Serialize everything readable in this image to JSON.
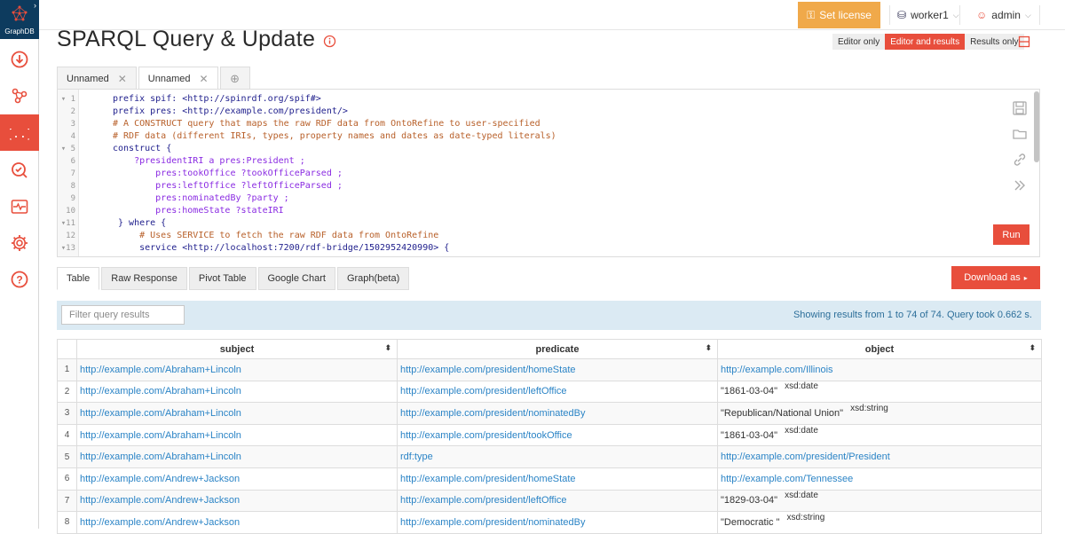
{
  "sidebar": {
    "logo_text": "GraphDB",
    "items": [
      {
        "name": "import",
        "active": false
      },
      {
        "name": "explore",
        "active": false
      },
      {
        "name": "sparql",
        "active": true
      },
      {
        "name": "monitor",
        "active": false
      },
      {
        "name": "activity",
        "active": false
      },
      {
        "name": "setup",
        "active": false
      },
      {
        "name": "help",
        "active": false
      }
    ]
  },
  "topbar": {
    "set_license": "Set license",
    "worker": "worker1",
    "admin": "admin"
  },
  "page": {
    "title": "SPARQL Query & Update"
  },
  "view_mode": {
    "editor_only": "Editor only",
    "editor_and_results": "Editor and results",
    "results_only": "Results only"
  },
  "query_tabs": [
    {
      "label": "Unnamed",
      "active": false
    },
    {
      "label": "Unnamed",
      "active": true
    }
  ],
  "editor": {
    "line_numbers": [
      "▾ 1",
      "2",
      "3",
      "4",
      "▾ 5",
      "6",
      "7",
      "8",
      "9",
      "10",
      "▾11",
      "12",
      "▾13"
    ],
    "lines": [
      "prefix spif: <http://spinrdf.org/spif#>",
      "prefix pres: <http://example.com/president/>",
      "# A CONSTRUCT query that maps the raw RDF data from OntoRefine to user-specified",
      "# RDF data (different IRIs, types, property names and dates as date-typed literals)",
      "construct {",
      "    ?presidentIRI a pres:President ;",
      "        pres:tookOffice ?tookOfficeParsed ;",
      "        pres:leftOffice ?leftOfficeParsed ;",
      "        pres:nominatedBy ?party ;",
      "        pres:homeState ?stateIRI",
      " } where {",
      "     # Uses SERVICE to fetch the raw RDF data from OntoRefine",
      "     service <http://localhost:7200/rdf-bridge/1502952420990> {"
    ],
    "run_label": "Run"
  },
  "result_tabs": [
    "Table",
    "Raw Response",
    "Pivot Table",
    "Google Chart",
    "Graph(beta)"
  ],
  "download_label": "Download as",
  "filter": {
    "placeholder": "Filter query results",
    "summary": "Showing results from 1 to 74 of 74. Query took 0.662 s."
  },
  "table": {
    "columns": [
      "subject",
      "predicate",
      "object"
    ],
    "rows": [
      {
        "n": "1",
        "s": "http://example.com/Abraham+Lincoln",
        "p": "http://example.com/president/homeState",
        "o": "http://example.com/Illinois",
        "o_type": "link",
        "dt": ""
      },
      {
        "n": "2",
        "s": "http://example.com/Abraham+Lincoln",
        "p": "http://example.com/president/leftOffice",
        "o": "\"1861-03-04\"",
        "o_type": "lit",
        "dt": "xsd:date"
      },
      {
        "n": "3",
        "s": "http://example.com/Abraham+Lincoln",
        "p": "http://example.com/president/nominatedBy",
        "o": "\"Republican/National Union\"",
        "o_type": "lit",
        "dt": "xsd:string"
      },
      {
        "n": "4",
        "s": "http://example.com/Abraham+Lincoln",
        "p": "http://example.com/president/tookOffice",
        "o": "\"1861-03-04\"",
        "o_type": "lit",
        "dt": "xsd:date"
      },
      {
        "n": "5",
        "s": "http://example.com/Abraham+Lincoln",
        "p": "rdf:type",
        "o": "http://example.com/president/President",
        "o_type": "link",
        "dt": ""
      },
      {
        "n": "6",
        "s": "http://example.com/Andrew+Jackson",
        "p": "http://example.com/president/homeState",
        "o": "http://example.com/Tennessee",
        "o_type": "link",
        "dt": ""
      },
      {
        "n": "7",
        "s": "http://example.com/Andrew+Jackson",
        "p": "http://example.com/president/leftOffice",
        "o": "\"1829-03-04\"",
        "o_type": "lit",
        "dt": "xsd:date"
      },
      {
        "n": "8",
        "s": "http://example.com/Andrew+Jackson",
        "p": "http://example.com/president/nominatedBy",
        "o": "\"Democratic \"",
        "o_type": "lit",
        "dt": "xsd:string"
      }
    ]
  },
  "colors": {
    "accent": "#e84e3c",
    "license": "#f0a94a",
    "logo_bg": "#0d3b5e",
    "link": "#2b84c6"
  }
}
